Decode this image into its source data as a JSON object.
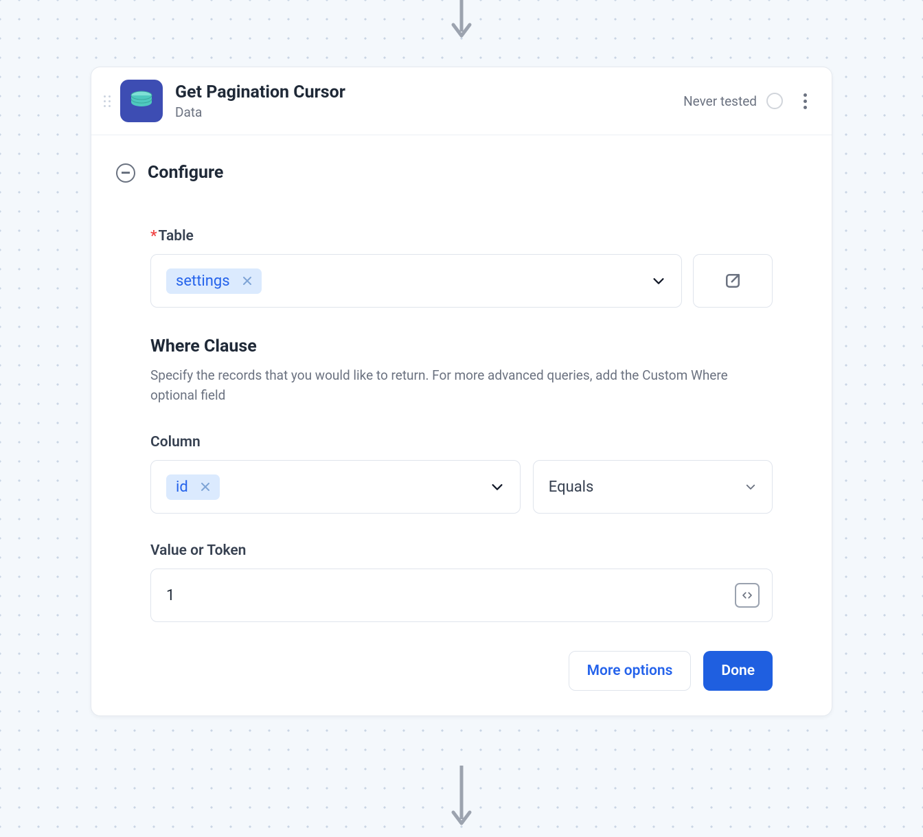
{
  "header": {
    "title": "Get Pagination Cursor",
    "subtitle": "Data",
    "status": "Never tested"
  },
  "configure": {
    "heading": "Configure",
    "table_label": "Table",
    "table_value": "settings",
    "where": {
      "title": "Where Clause",
      "desc": "Specify the records that you would like to return. For more advanced queries, add the Custom Where optional field"
    },
    "column_label": "Column",
    "column_value": "id",
    "operator_value": "Equals",
    "value_label": "Value or Token",
    "value": "1"
  },
  "footer": {
    "more": "More options",
    "done": "Done"
  }
}
